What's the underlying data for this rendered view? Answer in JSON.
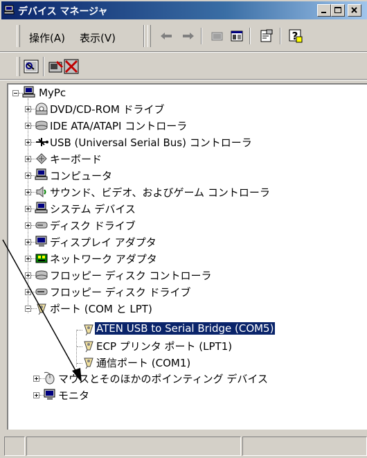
{
  "window": {
    "title": "デバイス マネージャ"
  },
  "menu": {
    "items": [
      "操作(A)",
      "表示(V)"
    ]
  },
  "tree": {
    "root": "MyPc",
    "categories": [
      {
        "label": "DVD/CD-ROM ドライブ",
        "icon": "dvd-drive-icon"
      },
      {
        "label": "IDE ATA/ATAPI コントローラ",
        "icon": "ide-controller-icon"
      },
      {
        "label": "USB (Universal Serial Bus) コントローラ",
        "icon": "usb-icon"
      },
      {
        "label": "キーボード",
        "icon": "keyboard-icon"
      },
      {
        "label": "コンピュータ",
        "icon": "computer-icon"
      },
      {
        "label": "サウンド、ビデオ、およびゲーム コントローラ",
        "icon": "sound-icon"
      },
      {
        "label": "システム デバイス",
        "icon": "system-device-icon"
      },
      {
        "label": "ディスク ドライブ",
        "icon": "disk-drive-icon"
      },
      {
        "label": "ディスプレイ アダプタ",
        "icon": "display-adapter-icon"
      },
      {
        "label": "ネットワーク アダプタ",
        "icon": "network-adapter-icon"
      },
      {
        "label": "フロッピー ディスク コントローラ",
        "icon": "floppy-controller-icon"
      },
      {
        "label": "フロッピー ディスク ドライブ",
        "icon": "floppy-drive-icon"
      },
      {
        "label": "ポート (COM と LPT)",
        "icon": "port-icon"
      }
    ],
    "ports_children": [
      {
        "label": "ATEN USB to Serial Bridge (COM5)",
        "selected": true
      },
      {
        "label": "ECP プリンタ ポート (LPT1)",
        "selected": false
      },
      {
        "label": "通信ポート (COM1)",
        "selected": false
      }
    ],
    "after": [
      {
        "label": "マウスとそのほかのポインティング デバイス",
        "icon": "mouse-icon"
      },
      {
        "label": "モニタ",
        "icon": "monitor-icon"
      }
    ]
  },
  "colors": {
    "selection": "#0a246a",
    "titlebar": "#0a246a",
    "face": "#d4d0c8"
  }
}
